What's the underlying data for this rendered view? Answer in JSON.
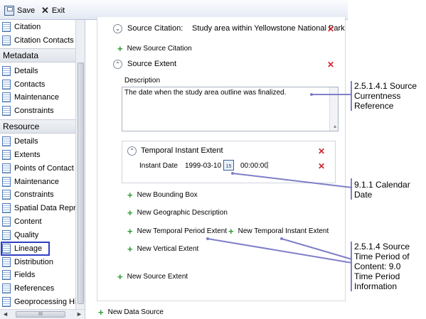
{
  "toolbar": {
    "save_label": "Save",
    "exit_label": "Exit"
  },
  "sidebar": {
    "top_items": [
      {
        "label": "Citation"
      },
      {
        "label": "Citation Contacts"
      }
    ],
    "metadata_header": "Metadata",
    "metadata_items": [
      {
        "label": "Details"
      },
      {
        "label": "Contacts"
      },
      {
        "label": "Maintenance"
      },
      {
        "label": "Constraints"
      }
    ],
    "resource_header": "Resource",
    "resource_items": [
      {
        "label": "Details"
      },
      {
        "label": "Extents"
      },
      {
        "label": "Points of Contact"
      },
      {
        "label": "Maintenance"
      },
      {
        "label": "Constraints"
      },
      {
        "label": "Spatial Data Representation"
      },
      {
        "label": "Content"
      },
      {
        "label": "Quality"
      },
      {
        "label": "Lineage"
      },
      {
        "label": "Distribution"
      },
      {
        "label": "Fields"
      },
      {
        "label": "References"
      },
      {
        "label": "Geoprocessing History"
      }
    ],
    "scroll_grip": "III"
  },
  "main": {
    "source_citation_label": "Source Citation:",
    "source_citation_value": "Study area within Yellowstone National Park",
    "new_source_citation": "New Source Citation",
    "source_extent_label": "Source Extent",
    "description_label": "Description",
    "description_value": "The date when the study area outline was finalized.",
    "temporal_instant_label": "Temporal Instant Extent",
    "instant_date_label": "Instant Date",
    "instant_date_value": "1999-03-10",
    "calendar_day": "15",
    "instant_time_value": "00:00:00",
    "new_bounding_box": "New Bounding Box",
    "new_geographic_description": "New Geographic Description",
    "new_temporal_period_extent": "New Temporal Period Extent",
    "new_temporal_instant_extent": "New Temporal Instant Extent",
    "new_vertical_extent": "New Vertical Extent",
    "new_source_extent": "New Source Extent",
    "new_data_source": "New Data Source"
  },
  "annotations": {
    "source_currentness": [
      "2.5.1.4.1 Source",
      "Currentness",
      "Reference"
    ],
    "calendar_date": [
      "9.1.1 Calendar",
      "Date"
    ],
    "time_period": [
      "2.5.1.4 Source",
      "Time Period of",
      "Content: 9.0",
      "Time Period",
      "Information"
    ],
    "line_color": "#7f7fc9",
    "highlight_color": "#2f3fc4"
  }
}
